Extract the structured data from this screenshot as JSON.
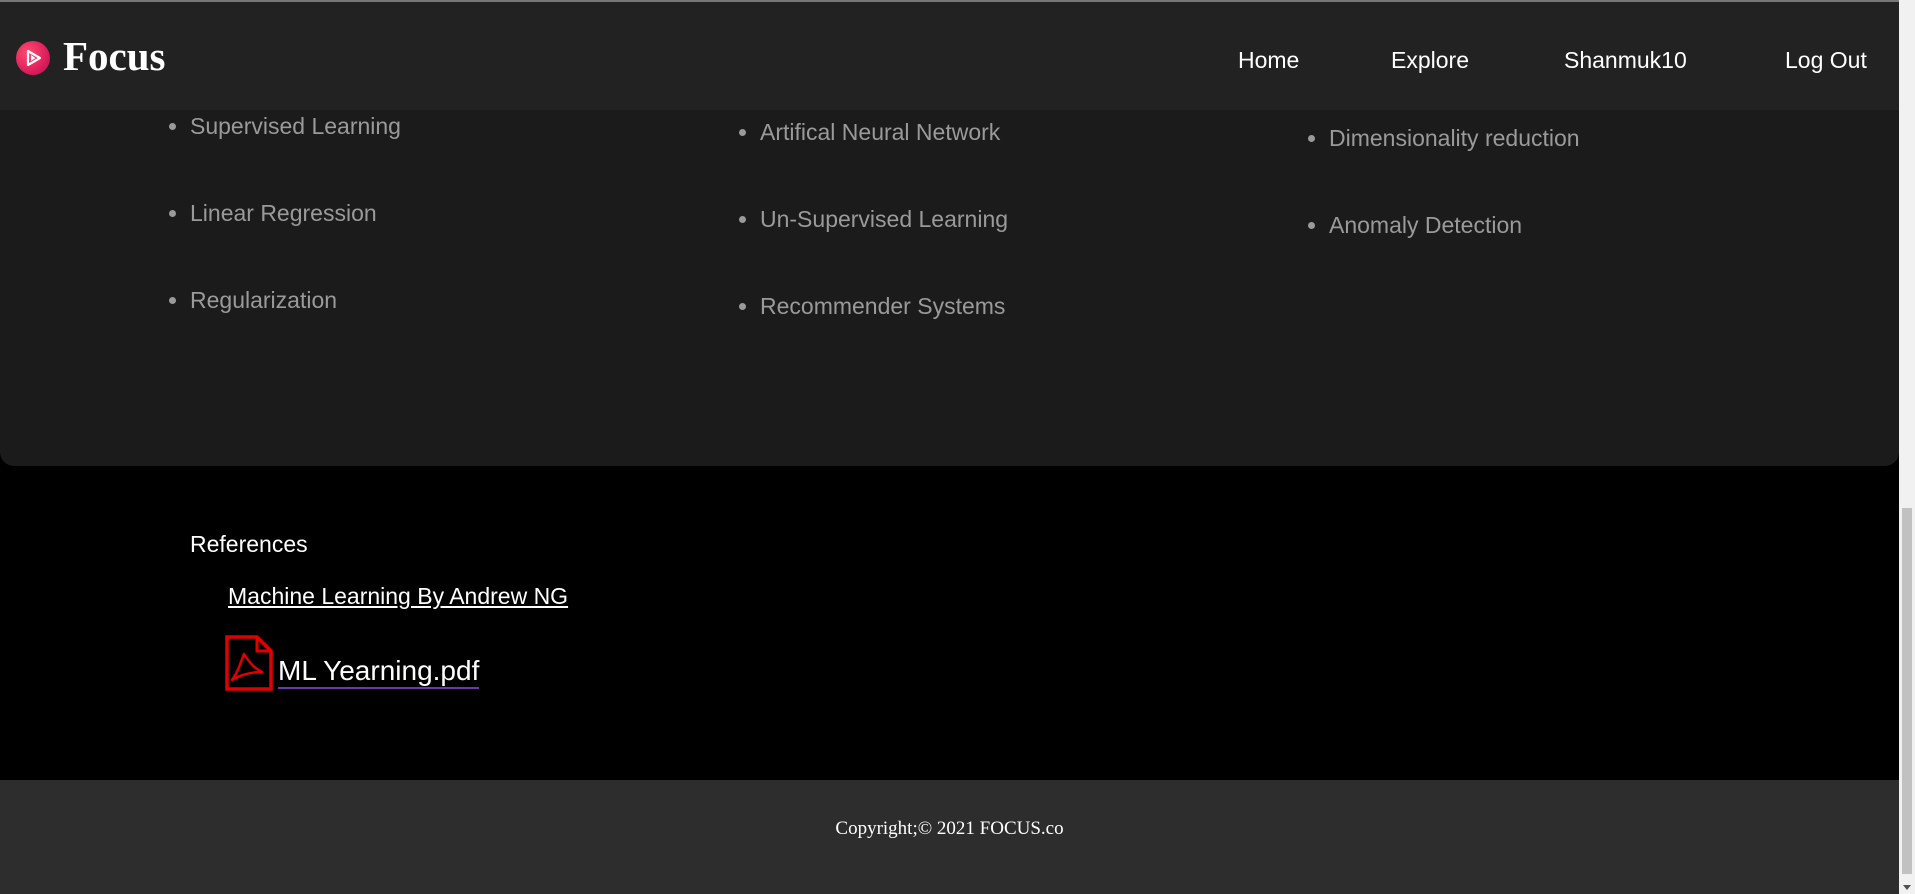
{
  "navbar": {
    "brand": "Focus",
    "links": [
      "Home",
      "Explore",
      "Shanmuk10",
      "Log Out"
    ]
  },
  "topics": {
    "column1": [
      "Supervised Learning",
      "Linear Regression",
      "Regularization"
    ],
    "column2": [
      "Artifical Neural Network",
      "Un-Supervised Learning",
      "Recommender Systems"
    ],
    "column3": [
      "Dimensionality reduction",
      "Anomaly Detection"
    ]
  },
  "references": {
    "heading": "References",
    "link": "Machine Learning By Andrew NG",
    "pdf": "ML Yearning.pdf"
  },
  "footer": {
    "copyright": "Copyright;© 2021 FOCUS.co"
  },
  "colors": {
    "accent": "#e8175d",
    "pdf_red": "#e00000"
  },
  "icons": {
    "logo": "play-circle-icon",
    "pdf": "pdf-file-icon"
  }
}
